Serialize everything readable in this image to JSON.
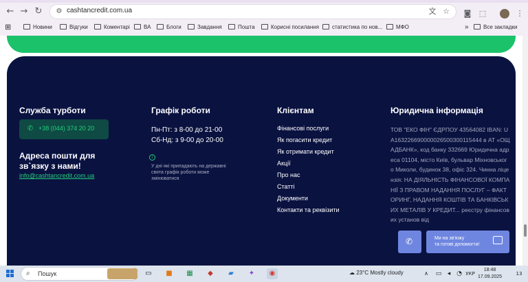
{
  "browser": {
    "url": "cashtancredit.com.ua",
    "bookmarks": [
      "Новини",
      "Відгуки",
      "Коментарі",
      "ВА",
      "Блоги",
      "Завдання",
      "Пошта",
      "Корисні посилання",
      "статистика по нов...",
      "МФО"
    ],
    "all_bookmarks": "Все закладки",
    "overflow": "»"
  },
  "footer": {
    "support_title": "Служба турботи",
    "phone": "+38 (044) 374 20 20",
    "mail_title": "Адреса пошти для зв`язку з нами!",
    "email": "info@cashtancredit.com.ua",
    "schedule_title": "Графік роботи",
    "schedule_weekdays": "Пн-Пт: з 8-00 до 21-00",
    "schedule_weekend": "Сб-Нд: з 9-00 до 20-00",
    "holiday_note": "У дні які припадають на державні свята графік роботи може змінюватися",
    "clients_title": "Клієнтам",
    "client_links": [
      "Фінансові послуги",
      "Як погасити кредит",
      "Як отримати кредит",
      "Акції",
      "Про нас",
      "Статті",
      "Документи",
      "Контакти та реквізити"
    ],
    "legal_title": "Юридична інформація",
    "legal_text": "ТОВ \"ЕКО ФІН\" ЄДРПОУ 43564082 IBAN: UA163226690000026500300115444 в АТ «ОЩАДБАНК», код банку 332669 Юридична адреса 01104, місто Київ, бульвар Міхновського Миколи, будинок 38, офіс 324. Чинна ліцензія: НА ДІЯЛЬНІСТЬ ФІНАНСОВОЇ КОМПАНІЇ З ПРАВОМ НАДАННЯ ПОСЛУГ – ФАКТОРИНГ, НАДАННЯ КОШТІВ ТА БАНКІВСЬКИХ МЕТАЛІВ У КРЕДИТ... реєстру фінансових установ від"
  },
  "chat": {
    "line1": "Ми на зв'язку",
    "line2": "та готові допомогти!"
  },
  "taskbar": {
    "search": "Пошук",
    "weather": "23°C  Mostly cloudy",
    "lang": "УКР",
    "time": "18:48",
    "date": "17.09.2025",
    "notif": "13"
  }
}
